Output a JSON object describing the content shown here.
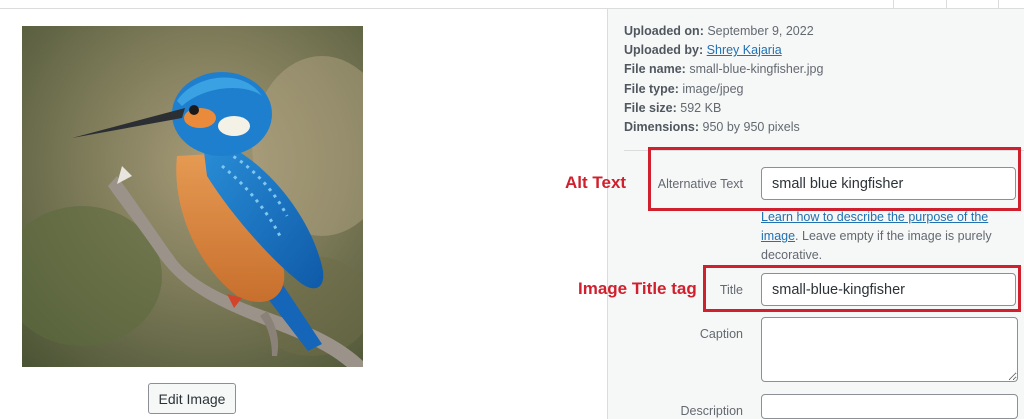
{
  "image": {
    "alt": "small blue kingfisher"
  },
  "edit_button_label": "Edit Image",
  "details": {
    "uploaded_on_label": "Uploaded on:",
    "uploaded_on": "September 9, 2022",
    "uploaded_by_label": "Uploaded by:",
    "uploaded_by": "Shrey Kajaria",
    "file_name_label": "File name:",
    "file_name": "small-blue-kingfisher.jpg",
    "file_type_label": "File type:",
    "file_type": "image/jpeg",
    "file_size_label": "File size:",
    "file_size": "592 KB",
    "dimensions_label": "Dimensions:",
    "dimensions": "950 by 950 pixels"
  },
  "fields": {
    "alt_label": "Alternative Text",
    "alt_value": "small blue kingfisher",
    "help_link": "Learn how to describe the purpose of the image",
    "help_rest": ". Leave empty if the image is purely decorative.",
    "title_label": "Title",
    "title_value": "small-blue-kingfisher",
    "caption_label": "Caption",
    "description_label": "Description"
  },
  "annotations": {
    "alt": "Alt Text",
    "title": "Image Title tag"
  },
  "colors": {
    "annotation": "#d0202e",
    "link": "#2271b1",
    "sidebar_bg": "#f6f7f7"
  }
}
